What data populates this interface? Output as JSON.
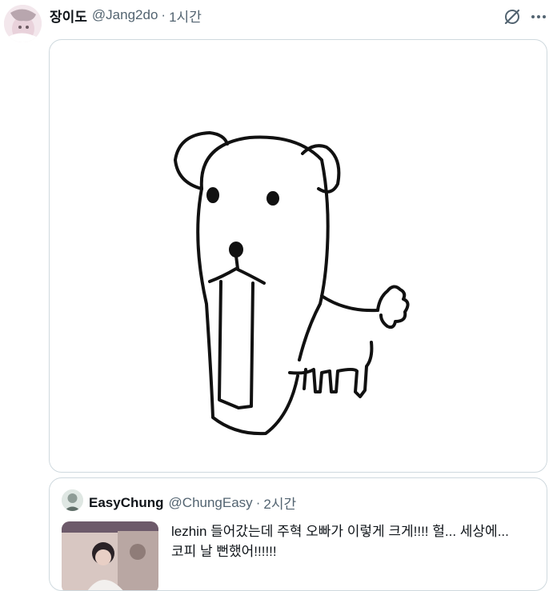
{
  "tweet": {
    "author_name": "장이도",
    "handle": "@Jang2do",
    "separator": "·",
    "time": "1시간",
    "icons": {
      "grok": "grok-icon",
      "more": "more-icon",
      "avatar": "avatar-image"
    }
  },
  "media": {
    "content": "dog-drawing"
  },
  "quote": {
    "author_name": "EasyChung",
    "handle": "@ChungEasy",
    "separator": "·",
    "time": "2시간",
    "text": "lezhin 들어갔는데 주혁 오빠가 이렇게 크게!!!! 헐... 세상에...\n코피 날 뻔했어!!!!!!"
  },
  "colors": {
    "text": "#0f1419",
    "secondary": "#536471",
    "border": "#cfd9de"
  }
}
